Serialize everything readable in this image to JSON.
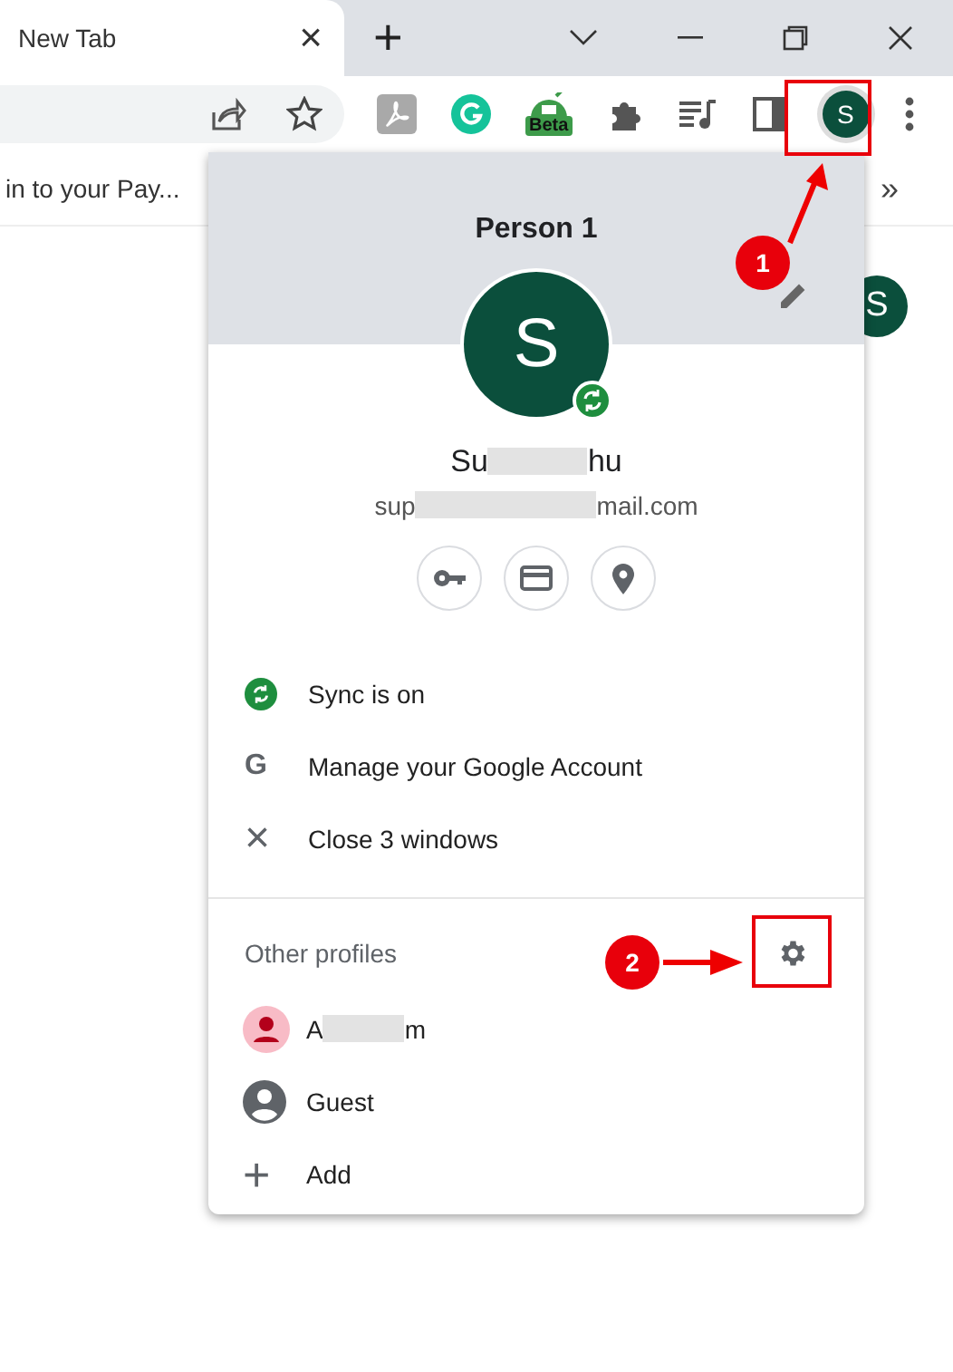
{
  "tab": {
    "title": "New Tab",
    "close": "×"
  },
  "new_tab": "+",
  "toolbar": {
    "beta_badge": "Beta",
    "avatar_letter": "S"
  },
  "bookmarks": {
    "item": "in to your Pay...",
    "overflow": "»"
  },
  "page_avatar_letter": "S",
  "profile_menu": {
    "title": "Person 1",
    "avatar_letter": "S",
    "synced": true,
    "name_parts": [
      "Su",
      "hu"
    ],
    "email_parts": [
      "sup",
      "mail.com"
    ],
    "items": [
      {
        "kind": "sync",
        "label": "Sync is on"
      },
      {
        "kind": "google",
        "icon": "G",
        "label": "Manage your Google Account"
      },
      {
        "kind": "close",
        "icon": "×",
        "label": "Close 3 windows"
      }
    ],
    "other_profiles_label": "Other profiles",
    "profiles": [
      {
        "kind": "person",
        "name_parts": [
          "A",
          "m"
        ]
      },
      {
        "kind": "guest",
        "label": "Guest"
      },
      {
        "kind": "add",
        "icon": "+",
        "label": "Add"
      }
    ]
  },
  "annotations": [
    {
      "number": "1"
    },
    {
      "number": "2"
    }
  ]
}
